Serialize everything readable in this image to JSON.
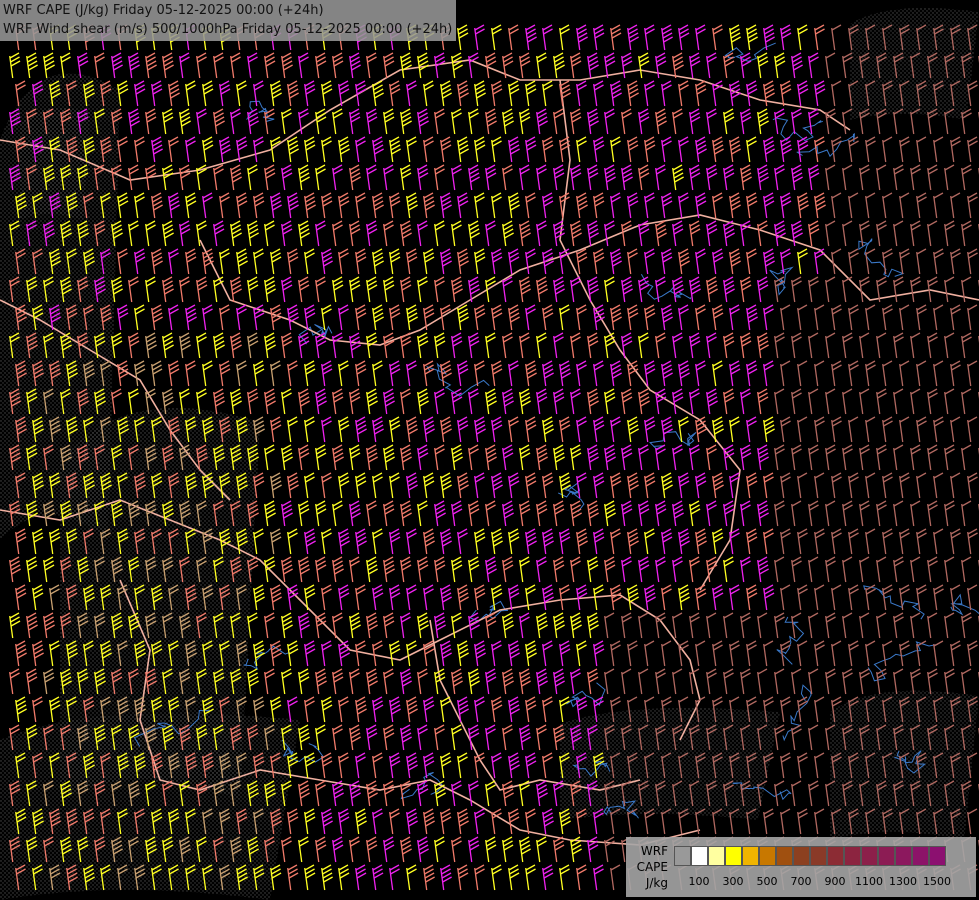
{
  "title": {
    "line1": "WRF CAPE (J/kg) Friday 05-12-2025 00:00 (+24h)",
    "line2": "WRF Wind shear (m/s) 500/1000hPa Friday 05-12-2025 00:00 (+24h)"
  },
  "legend": {
    "model": "WRF",
    "variable": "CAPE",
    "unit": "J/kg",
    "swatch_colors": [
      "#999999",
      "#ffffff",
      "#ffffa0",
      "#ffff00",
      "#f0b400",
      "#c87800",
      "#a05010",
      "#8c4020",
      "#8a3a28",
      "#8c2c34",
      "#8c2440",
      "#8c204a",
      "#8c1c54",
      "#8c185e",
      "#8c1468",
      "#8c1070"
    ],
    "tick_labels": [
      "100",
      "300",
      "500",
      "700",
      "900",
      "1100",
      "1300",
      "1500"
    ]
  },
  "colors": {
    "background": "#000000",
    "barb_pink": "#f07a6a",
    "barb_magenta": "#ee22ee",
    "barb_yellow": "#ffff22",
    "barb_tan": "#c8a070",
    "barb_dim": "#b06860",
    "border": "#f0b0a0",
    "river": "#3a78c8"
  }
}
